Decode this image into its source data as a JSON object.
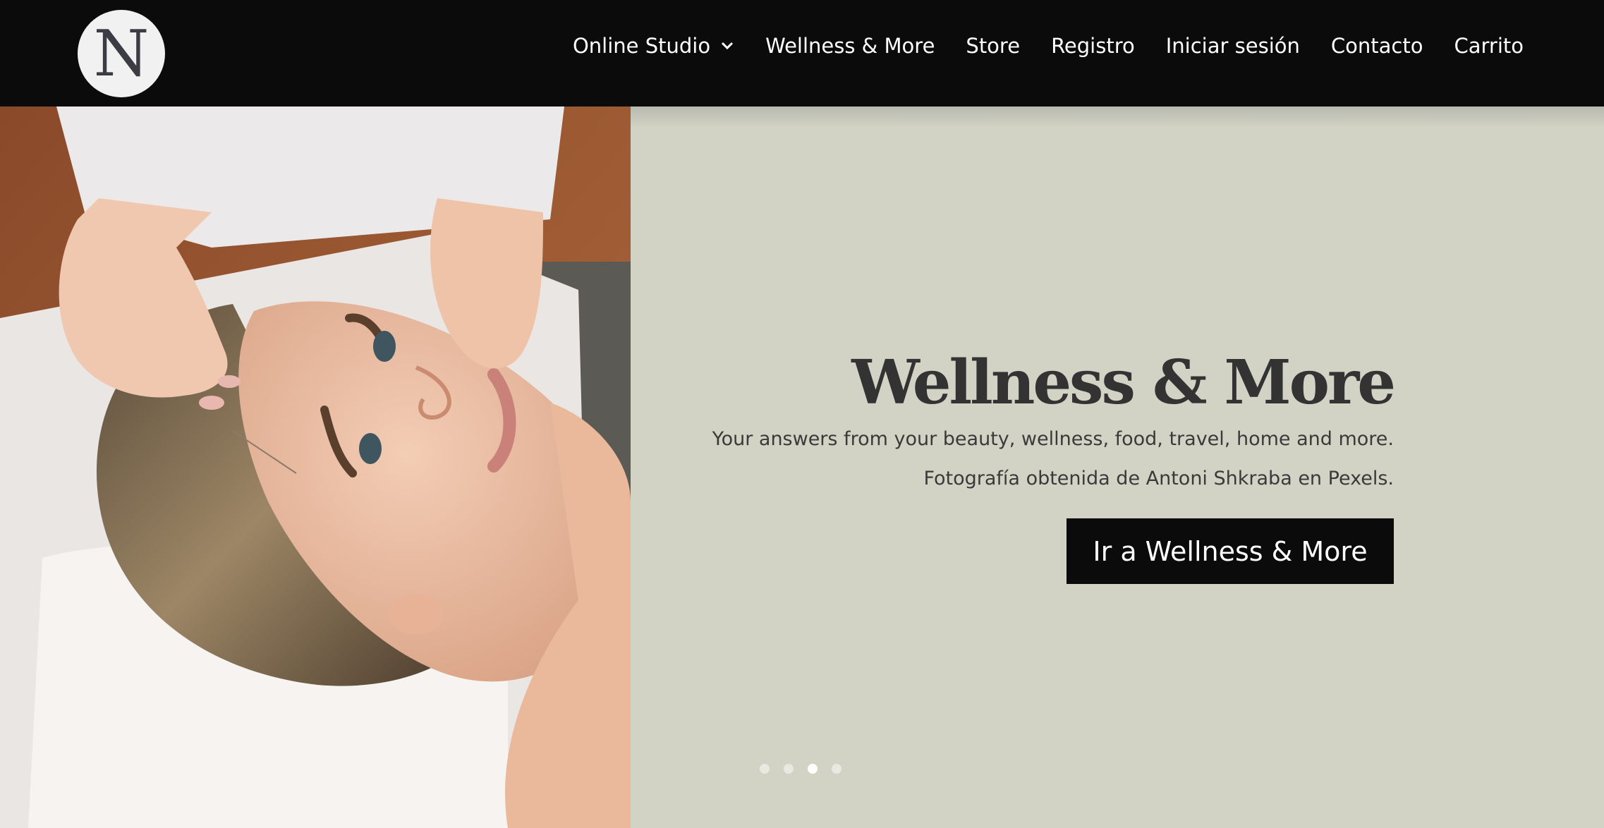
{
  "header": {
    "logo_letter": "N",
    "nav": [
      {
        "label": "Online Studio",
        "has_dropdown": true
      },
      {
        "label": "Wellness & More"
      },
      {
        "label": "Store"
      },
      {
        "label": "Registro"
      },
      {
        "label": "Iniciar sesión"
      },
      {
        "label": "Contacto"
      },
      {
        "label": "Carrito"
      }
    ]
  },
  "hero": {
    "title": "Wellness & More",
    "subtitle": "Your answers from your beauty, wellness, food, travel, home and more.",
    "credit": "Fotografía obtenida de Antoni Shkraba en Pexels.",
    "cta_label": "Ir a Wellness & More",
    "slider": {
      "count": 4,
      "active_index": 3
    }
  },
  "colors": {
    "header_bg": "#0b0b0b",
    "panel_bg": "#d2d3c4",
    "title": "#333333",
    "button_bg": "#0b0b0b",
    "button_text": "#ffffff"
  },
  "icons": {
    "nav_dropdown": "chevron-down-icon",
    "logo": "logo-circle-icon"
  }
}
